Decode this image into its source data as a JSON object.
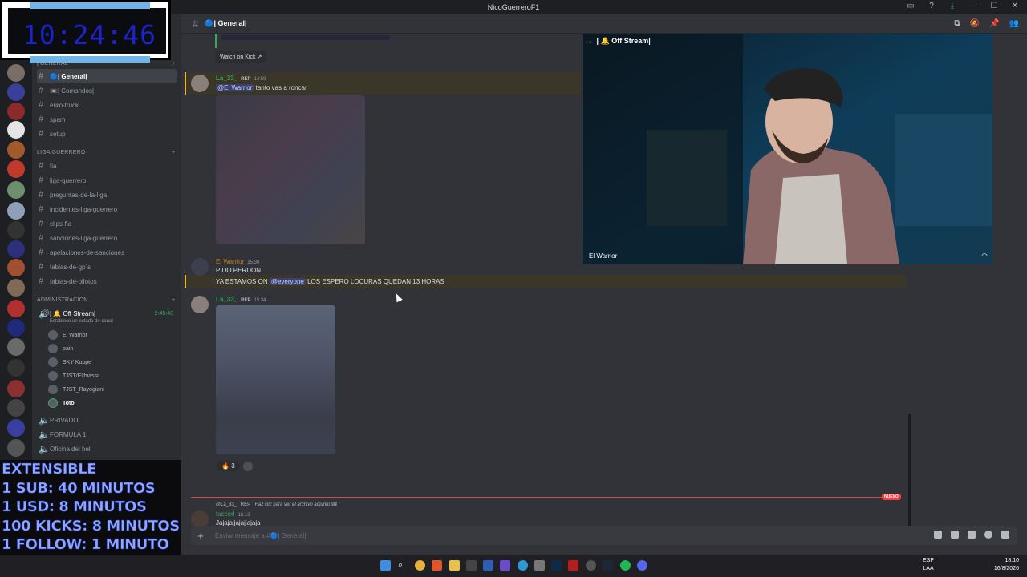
{
  "window": {
    "title": "NicoGuerreroF1"
  },
  "timer": {
    "time": "10:24:46"
  },
  "header": {
    "channel": "🔵| General|"
  },
  "categories": {
    "general": "| GENERAL",
    "liga": "LIGA GUERRERO",
    "admin": "ADMINISTRACION"
  },
  "channels": {
    "general": "🔵| General|",
    "comandos": "📼| Comandos|",
    "euro_truck": "euro-truck",
    "spam": "spam",
    "setup": "setup",
    "fia": "fia",
    "liga_guerrero": "liga-guerrero",
    "preguntas": "preguntas-de-la-liga",
    "incidentes": "incidentes-liga-guerrero",
    "clips": "clips-fia",
    "sanciones": "sanciones-liga-guerrero",
    "apelaciones": "apelaciones-de-sanciones",
    "tablas_gp": "tablas-de-gp´s",
    "tablas_pilotos": "tablas-de-pilotos",
    "off_stream": "| 🔔 Off Stream|",
    "off_stream_time": "2:45:48",
    "off_stream_sub": "Establece un estado de canal",
    "privado": "PRIVADO",
    "formula1": "FORMULA 1",
    "oficina": "Oficina del heli"
  },
  "voice_users": [
    "El Warrior",
    "pain",
    "SKY Kuppe",
    "TJST/Elthiassi",
    "TJST_Rayogiani",
    "Toto"
  ],
  "overlay": {
    "line1": "EXTENSIBLE",
    "line2": "1 SUB: 40 MINUTOS",
    "line3": "1 USD: 8 MINUTOS",
    "line4": "100 KICKS: 8 MINUTOS",
    "line5": "1 FOLLOW: 1 MINUTO"
  },
  "messages": {
    "watch_kick": "Watch on Kick",
    "m1_name": "La_33_",
    "m1_rep": "REP",
    "m1_time": "14:59",
    "m1_mention": "@El Warrior",
    "m1_text": "tanto vas a roncar",
    "m2_name": "El Warrior",
    "m2_time": "15:30",
    "m2_text1": "PIDO PERDON",
    "m2_text2a": "YA ESTAMOS ON",
    "m2_mention": "@everyone",
    "m2_text2b": "LOS ESPERO LOCURAS QUEDAN 13 HORAS",
    "m3_name": "La_33_",
    "m3_rep": "REP",
    "m3_time": "15:34",
    "react_count": "3",
    "new_label": "NUEVO",
    "reply_ref_name": "@La_33_",
    "reply_ref_rep": "REP",
    "reply_ref_text": "Haz clic para ver el archivo adjunto",
    "m4_name": "tuccerl",
    "m4_time": "16:13",
    "m4_text": "Jajajajjajajjajaja"
  },
  "composer": {
    "placeholder": "Enviar mensaje a #🔵| General|"
  },
  "video": {
    "title": "| 🔔 Off Stream|",
    "streamer": "El Warrior"
  },
  "taskbar": {
    "lang1": "ESP",
    "lang2": "LAA",
    "time": "18:10",
    "date": "16/8/2026"
  },
  "colors": {
    "accent": "#5865f2",
    "mention_bg": "#3c4270",
    "new_red": "#f23f43",
    "warrior_name": "#c27c0e",
    "green_name": "#3ba55c"
  }
}
